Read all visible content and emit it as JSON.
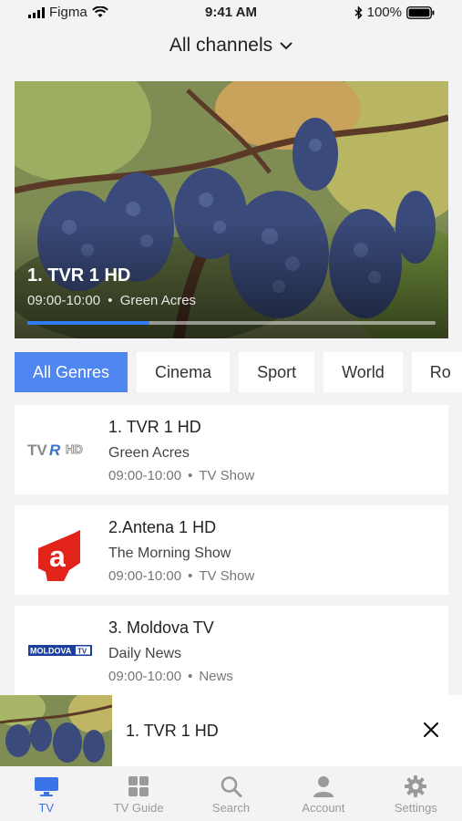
{
  "status_bar": {
    "carrier": "Figma",
    "time": "9:41 AM",
    "battery": "100%"
  },
  "header": {
    "title": "All channels"
  },
  "hero": {
    "channel": "1. TVR 1 HD",
    "time": "09:00-10:00",
    "show": "Green Acres",
    "separator": "•",
    "progress": 0.3
  },
  "genres": [
    {
      "label": "All Genres",
      "active": true
    },
    {
      "label": "Cinema",
      "active": false
    },
    {
      "label": "Sport",
      "active": false
    },
    {
      "label": "World",
      "active": false
    },
    {
      "label": "Ro",
      "active": false
    }
  ],
  "channels": [
    {
      "name": "1. TVR  1 HD",
      "show": "Green Acres",
      "time": "09:00-10:00",
      "separator": "•",
      "category": "TV Show"
    },
    {
      "name": "2.Antena 1 HD",
      "show": "The Morning Show",
      "time": "09:00-10:00",
      "separator": "•",
      "category": "TV Show"
    },
    {
      "name": "3. Moldova TV",
      "show": "Daily News",
      "time": "09:00-10:00",
      "separator": "•",
      "category": "News"
    }
  ],
  "mini_player": {
    "channel": "1. TVR  1 HD"
  },
  "tabs": [
    {
      "label": "TV",
      "icon": "tv-icon",
      "active": true
    },
    {
      "label": "TV Guide",
      "icon": "grid-icon",
      "active": false
    },
    {
      "label": "Search",
      "icon": "search-icon",
      "active": false
    },
    {
      "label": "Account",
      "icon": "person-icon",
      "active": false
    },
    {
      "label": "Settings",
      "icon": "gear-icon",
      "active": false
    }
  ],
  "logos": {
    "tvr": {
      "text_a": "TV",
      "text_b": "R",
      "text_c": "HD"
    },
    "antena": {
      "text": "a"
    },
    "moldova": {
      "text_a": "MOLDOVA",
      "text_b": "TV"
    }
  },
  "colors": {
    "accent": "#4f86f0",
    "tab_active": "#3a73e8",
    "progress": "#2f7df6",
    "antena_red": "#e2231a",
    "moldova_blue": "#1b3f9e"
  }
}
